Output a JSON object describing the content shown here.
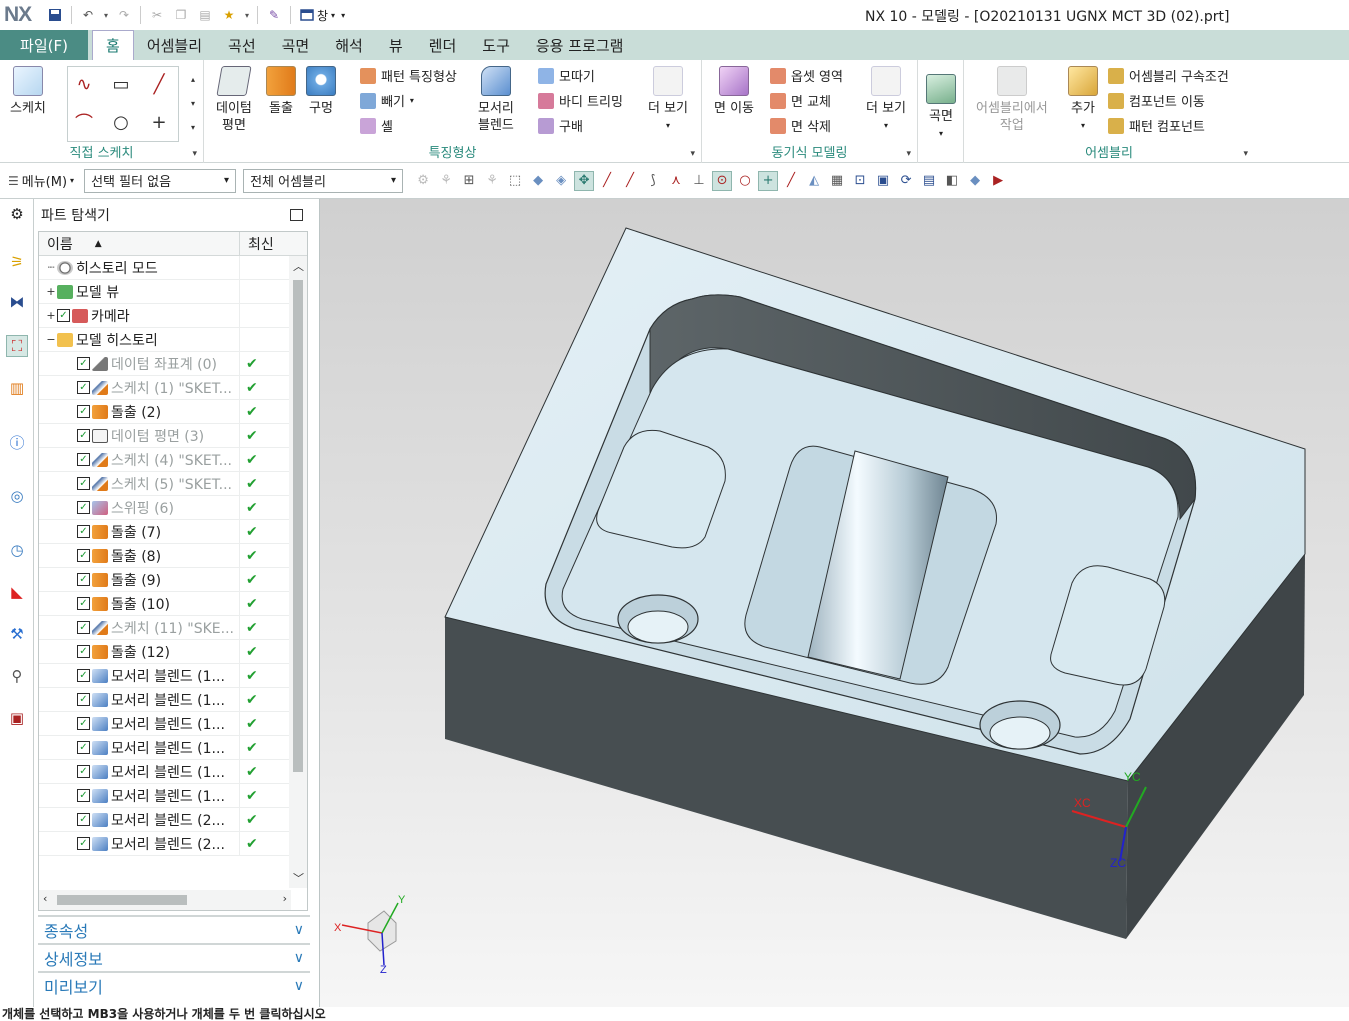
{
  "app": {
    "logo": "NX",
    "window_title": "NX 10 - 모델링 - [O20210131 UGNX MCT 3D (02).prt]",
    "window_menu_label": "창"
  },
  "tabs": [
    "홈",
    "어셈블리",
    "곡선",
    "곡면",
    "해석",
    "뷰",
    "렌더",
    "도구",
    "응용 프로그램"
  ],
  "file_tab": "파일(F)",
  "ribbon": {
    "sketch_group": {
      "label": "직접 스케치",
      "sketch_button": "스케치"
    },
    "feature_group": {
      "label": "특징형상",
      "datum_plane": "데이텀\n평면",
      "datum_line1": "데이텀",
      "datum_line2": "평면",
      "extrude": "돌출",
      "hole": "구멍",
      "pattern_feature": "패턴 특징형상",
      "subtract": "빼기",
      "shell": "셸",
      "edge_blend_line1": "모서리",
      "edge_blend_line2": "블렌드",
      "chamfer": "모따기",
      "trim_body": "바디 트리밍",
      "draft": "구배",
      "more": "더 보기"
    },
    "sync_group": {
      "label": "동기식 모델링",
      "move_face": "면 이동",
      "offset_region": "옵셋 영역",
      "replace_face": "면 교체",
      "delete_face": "면 삭제",
      "more": "더 보기"
    },
    "surface_button": "곡면",
    "assembly_group": {
      "label": "어셈블리",
      "work_in_assembly_line1": "어셈블리에서",
      "work_in_assembly_line2": "작업",
      "add": "추가",
      "constraints": "어셈블리 구속조건",
      "move_component": "컴포넌트 이동",
      "pattern_component": "패턴 컴포넌트"
    }
  },
  "selbar": {
    "menu": "메뉴(M)",
    "filter": "선택 필터 없음",
    "scope": "전체 어셈블리"
  },
  "navigator": {
    "title": "파트 탐색기",
    "col_name": "이름",
    "col_latest": "최신",
    "nodes": [
      {
        "label": "히스토리 모드",
        "type": "clock",
        "indent": 0,
        "grey": false,
        "check": false,
        "latest": false,
        "expander": ""
      },
      {
        "label": "모델 뷰",
        "type": "view",
        "indent": 0,
        "grey": false,
        "check": false,
        "latest": false,
        "expander": "+"
      },
      {
        "label": "카메라",
        "type": "camera",
        "indent": 0,
        "grey": false,
        "check": true,
        "latest": false,
        "expander": "+"
      },
      {
        "label": "모델 히스토리",
        "type": "folder",
        "indent": 0,
        "grey": false,
        "check": false,
        "latest": false,
        "expander": "−"
      },
      {
        "label": "데이텀 좌표계 (0)",
        "type": "csys",
        "indent": 1,
        "grey": true,
        "check": true,
        "latest": true,
        "expander": ""
      },
      {
        "label": "스케치 (1) \"SKET...",
        "type": "sketch",
        "indent": 1,
        "grey": true,
        "check": true,
        "latest": true,
        "expander": ""
      },
      {
        "label": "돌출 (2)",
        "type": "extrude",
        "indent": 1,
        "grey": false,
        "check": true,
        "latest": true,
        "expander": ""
      },
      {
        "label": "데이텀 평면 (3)",
        "type": "plane",
        "indent": 1,
        "grey": true,
        "check": true,
        "latest": true,
        "expander": ""
      },
      {
        "label": "스케치 (4) \"SKET...",
        "type": "sketch",
        "indent": 1,
        "grey": true,
        "check": true,
        "latest": true,
        "expander": ""
      },
      {
        "label": "스케치 (5) \"SKET...",
        "type": "sketch",
        "indent": 1,
        "grey": true,
        "check": true,
        "latest": true,
        "expander": ""
      },
      {
        "label": "스위핑 (6)",
        "type": "sweep",
        "indent": 1,
        "grey": true,
        "check": true,
        "latest": true,
        "expander": ""
      },
      {
        "label": "돌출 (7)",
        "type": "extrude",
        "indent": 1,
        "grey": false,
        "check": true,
        "latest": true,
        "expander": ""
      },
      {
        "label": "돌출 (8)",
        "type": "extrude",
        "indent": 1,
        "grey": false,
        "check": true,
        "latest": true,
        "expander": ""
      },
      {
        "label": "돌출 (9)",
        "type": "extrude",
        "indent": 1,
        "grey": false,
        "check": true,
        "latest": true,
        "expander": ""
      },
      {
        "label": "돌출 (10)",
        "type": "extrude",
        "indent": 1,
        "grey": false,
        "check": true,
        "latest": true,
        "expander": ""
      },
      {
        "label": "스케치 (11) \"SKE...",
        "type": "sketch",
        "indent": 1,
        "grey": true,
        "check": true,
        "latest": true,
        "expander": ""
      },
      {
        "label": "돌출 (12)",
        "type": "extrude",
        "indent": 1,
        "grey": false,
        "check": true,
        "latest": true,
        "expander": ""
      },
      {
        "label": "모서리 블렌드 (1...",
        "type": "blend",
        "indent": 1,
        "grey": false,
        "check": true,
        "latest": true,
        "expander": ""
      },
      {
        "label": "모서리 블렌드 (1...",
        "type": "blend",
        "indent": 1,
        "grey": false,
        "check": true,
        "latest": true,
        "expander": ""
      },
      {
        "label": "모서리 블렌드 (1...",
        "type": "blend",
        "indent": 1,
        "grey": false,
        "check": true,
        "latest": true,
        "expander": ""
      },
      {
        "label": "모서리 블렌드 (1...",
        "type": "blend",
        "indent": 1,
        "grey": false,
        "check": true,
        "latest": true,
        "expander": ""
      },
      {
        "label": "모서리 블렌드 (1...",
        "type": "blend",
        "indent": 1,
        "grey": false,
        "check": true,
        "latest": true,
        "expander": ""
      },
      {
        "label": "모서리 블렌드 (1...",
        "type": "blend",
        "indent": 1,
        "grey": false,
        "check": true,
        "latest": true,
        "expander": ""
      },
      {
        "label": "모서리 블렌드 (2...",
        "type": "blend",
        "indent": 1,
        "grey": false,
        "check": true,
        "latest": true,
        "expander": ""
      },
      {
        "label": "모서리 블렌드 (2...",
        "type": "blend",
        "indent": 1,
        "grey": false,
        "check": true,
        "latest": true,
        "expander": ""
      }
    ],
    "panels": [
      "종속성",
      "상세정보",
      "미리보기"
    ]
  },
  "viewport": {
    "axis_labels": {
      "xc": "XC",
      "yc": "YC",
      "zc": "ZC",
      "x": "X",
      "y": "Y",
      "z": "Z"
    },
    "colors": {
      "top_face": "#d6e7ef",
      "side_face": "#4b5255",
      "accent": "#4b8c84"
    }
  },
  "status_text": "개체를 선택하고 MB3을 사용하거나 개체를 두 번 클릭하십시오"
}
